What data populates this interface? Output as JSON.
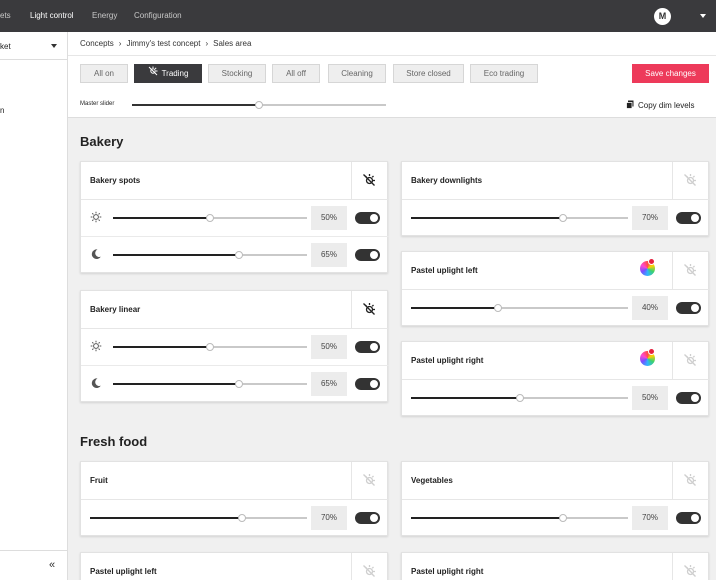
{
  "nav": {
    "items": [
      "ets",
      "Light control",
      "Energy",
      "Configuration"
    ],
    "avatar": "M"
  },
  "sidebar": {
    "store": "ket",
    "fragment": "n",
    "collapse_icon": "«"
  },
  "breadcrumb": [
    "Concepts",
    "Jimmy's test concept",
    "Sales area"
  ],
  "breadcrumb_sep": "›",
  "modes": [
    "All on",
    "Trading",
    "Stocking",
    "All off",
    "Cleaning",
    "Store closed",
    "Eco trading"
  ],
  "active_mode": "Trading",
  "save_label": "Save changes",
  "master": {
    "label": "Master slider",
    "value": 50
  },
  "copy_label": "Copy dim levels",
  "sections": [
    "Bakery",
    "Fresh food"
  ],
  "cards": [
    {
      "title": "Bakery spots",
      "icon": "light-dimmed-icon",
      "icon_active": true,
      "rows": [
        {
          "icon": "sun-icon",
          "value": 50,
          "label": "50%",
          "on": true
        },
        {
          "icon": "moon-icon",
          "value": 65,
          "label": "65%",
          "on": true
        }
      ]
    },
    {
      "title": "Bakery linear",
      "icon": "light-dimmed-icon",
      "icon_active": true,
      "rows": [
        {
          "icon": "sun-icon",
          "value": 50,
          "label": "50%",
          "on": true
        },
        {
          "icon": "moon-icon",
          "value": 65,
          "label": "65%",
          "on": true
        }
      ]
    },
    {
      "title": "Bakery downlights",
      "icon": "light-dimmed-icon",
      "icon_active": false,
      "rows": [
        {
          "value": 70,
          "label": "70%",
          "on": true
        }
      ]
    },
    {
      "title": "Pastel uplight left",
      "icon": "light-dimmed-icon",
      "icon_active": false,
      "color_picker": true,
      "rows": [
        {
          "value": 40,
          "label": "40%",
          "on": true
        }
      ]
    },
    {
      "title": "Pastel uplight right",
      "icon": "light-dimmed-icon",
      "icon_active": false,
      "color_picker": true,
      "rows": [
        {
          "value": 50,
          "label": "50%",
          "on": true
        }
      ]
    },
    {
      "title": "Fruit",
      "icon": "light-dimmed-icon",
      "icon_active": false,
      "rows": [
        {
          "value": 70,
          "label": "70%",
          "on": true
        }
      ]
    },
    {
      "title": "Vegetables",
      "icon": "light-dimmed-icon",
      "icon_active": false,
      "rows": [
        {
          "value": 70,
          "label": "70%",
          "on": true
        }
      ]
    },
    {
      "title": "Pastel uplight left",
      "icon": "light-dimmed-icon",
      "icon_active": false,
      "rows": []
    },
    {
      "title": "Pastel uplight right",
      "icon": "light-dimmed-icon",
      "icon_active": false,
      "rows": []
    }
  ],
  "colors": {
    "topbar": "#3a3a3d",
    "accent": "#ed3a5a",
    "background": "#f0f0f0"
  }
}
